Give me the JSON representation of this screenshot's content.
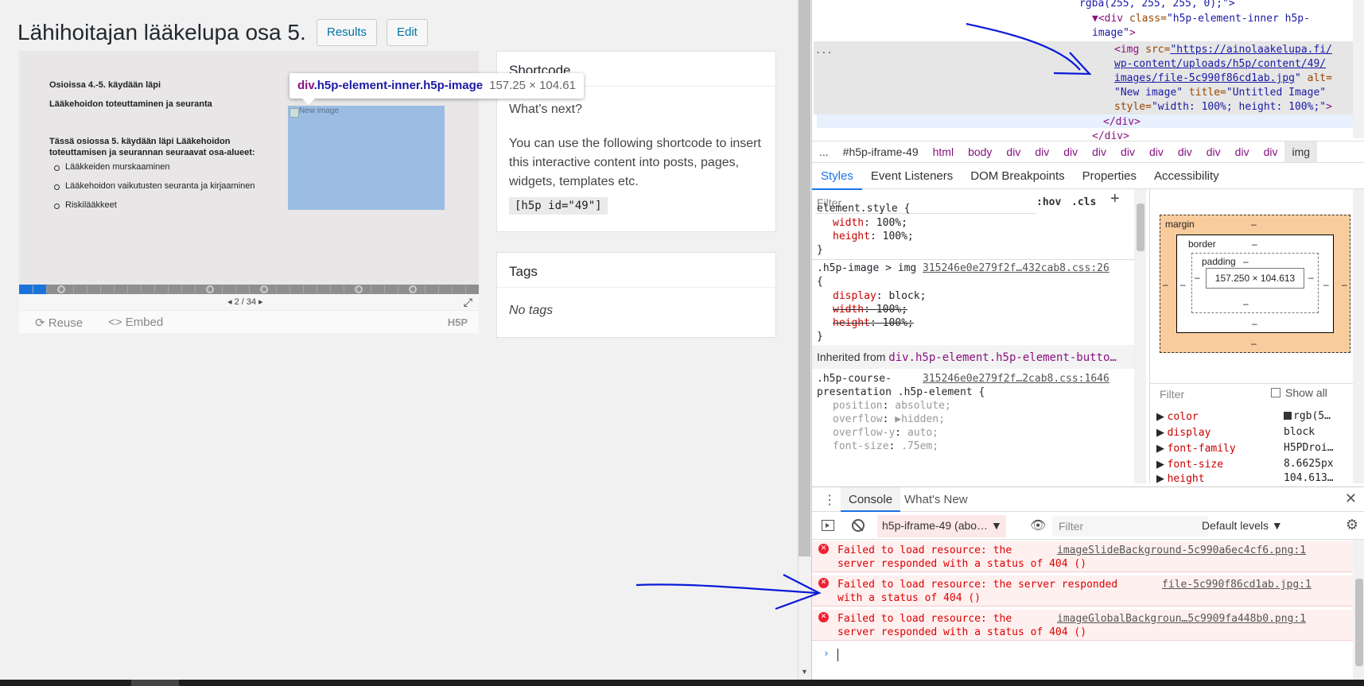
{
  "wp": {
    "title": "Lähihoitajan lääkelupa osa 5.",
    "results_label": "Results",
    "edit_label": "Edit"
  },
  "slide": {
    "heading1": "Osioissa 4.-5. käydään läpi",
    "heading2": "Lääkehoidon toteuttaminen ja seuranta",
    "intro_line1": "Tässä osiossa 5. käydään läpi Lääkehoidon",
    "intro_line2": "toteuttamisen ja seurannan seuraavat osa-alueet:",
    "bullets": [
      "Lääkkeiden murskaaminen",
      "Lääkehoidon vaikutusten seuranta ja kirjaaminen",
      "Riskilääkkeet"
    ],
    "image_alt": "New image",
    "counter": "2 / 34",
    "progress": 0.06
  },
  "h5p_actions": {
    "reuse": "Reuse",
    "embed": "<> Embed",
    "logo": "H5P"
  },
  "tooltip": {
    "tag": "div",
    "classes": ".h5p-element-inner.h5p-image",
    "size": "157.25 × 104.61"
  },
  "shortcode": {
    "title": "Shortcode",
    "whats_next": "What's next?",
    "description": "You can use the following shortcode to insert this interactive content into posts, pages, widgets, templates etc.",
    "code": "[h5p id=\"49\"]"
  },
  "tags": {
    "title": "Tags",
    "empty": "No tags"
  },
  "elements_panel": {
    "line1": "rgba(255, 255, 255, 0);\">",
    "line2_tag": "▼<div ",
    "line2_attr": "class=",
    "line2_val": "\"h5p-element-inner h5p-",
    "line3_val": "image\"",
    "line3_end": ">",
    "img_open": "<img ",
    "img_src_attr": "src=",
    "img_src_1": "\"https://ainolaakelupa.fi/",
    "img_src_2": "wp-content/uploads/h5p/content/49/",
    "img_src_3": "images/file-5c990f86cd1ab.jpg",
    "img_alt_attr": " alt=",
    "img_alt_val": "\"New image\"",
    "img_title_attr": " title=",
    "img_title_val": "\"Untitled Image\"",
    "img_style_attr": "style=",
    "img_style_val": "\"width: 100%; height: 100%;\"",
    "img_close": ">",
    "close_div1": "</div>",
    "close_div2": "</div>",
    "dots": "..."
  },
  "breadcrumbs": [
    "...",
    "#h5p-iframe-49",
    "html",
    "body",
    "div",
    "div",
    "div",
    "div",
    "div",
    "div",
    "div",
    "div",
    "div",
    "div",
    "img"
  ],
  "subtabs": [
    "Styles",
    "Event Listeners",
    "DOM Breakpoints",
    "Properties",
    "Accessibility"
  ],
  "styles": {
    "filter_placeholder": "Filter",
    "hov": ":hov",
    "cls": ".cls",
    "plus": "+",
    "rule1_selector": "element.style {",
    "rule1_props": [
      [
        "width",
        "100%;"
      ],
      [
        "height",
        "100%;"
      ]
    ],
    "close_brace": "}",
    "rule2_selector": ".h5p-image > img",
    "rule2_open": "{",
    "rule2_source": "315246e0e279f2f…432cab8.css:26",
    "rule2_props": [
      [
        "display",
        "block;"
      ],
      [
        "width",
        "100%;"
      ],
      [
        "height",
        "100%;"
      ]
    ],
    "inherited_label": "Inherited from ",
    "inherited_selector": "div.h5p-element.h5p-element-butto…",
    "rule3_selector_1": ".h5p-course-",
    "rule3_selector_2": "presentation .h5p-element {",
    "rule3_source": "315246e0e279f2f…2cab8.css:1646",
    "rule3_props": [
      [
        "position",
        "absolute;"
      ],
      [
        "overflow",
        "▶hidden;"
      ],
      [
        "overflow-y",
        "auto;"
      ],
      [
        "font-size",
        ".75em;"
      ]
    ]
  },
  "box_model": {
    "margin": "margin",
    "border": "border",
    "padding": "padding",
    "dash": "–",
    "content": "157.250 × 104.613"
  },
  "computed": {
    "filter_placeholder": "Filter",
    "show_all": "Show all",
    "props": [
      {
        "name": "color",
        "value": "rgb(5…"
      },
      {
        "name": "display",
        "value": "block"
      },
      {
        "name": "font-family",
        "value": "H5PDroi…"
      },
      {
        "name": "font-size",
        "value": "8.6625px"
      },
      {
        "name": "height",
        "value": "104.613…"
      }
    ]
  },
  "console": {
    "tab_console": "Console",
    "tab_whats_new": "What's New",
    "context": "h5p-iframe-49 (abo…",
    "filter_placeholder": "Filter",
    "levels": "Default levels ▼",
    "messages": [
      {
        "line1": "Failed to load resource: the",
        "line2": "server responded with a status of 404 ()",
        "source": "imageSlideBackground-5c990a6ec4cf6.png:1"
      },
      {
        "line1": "Failed to load resource: the server responded",
        "line2": "with a status of 404 ()",
        "source": "file-5c990f86cd1ab.jpg:1"
      },
      {
        "line1": "Failed to load resource: the",
        "line2": "server responded with a status of 404 ()",
        "source": "imageGlobalBackgroun…5c9909fa448b0.png:1"
      }
    ],
    "prompt": "›"
  },
  "colors": {
    "accent_blue": "#1a73e8",
    "error_red": "#d00000",
    "annotation_blue": "#0a1ad8"
  }
}
